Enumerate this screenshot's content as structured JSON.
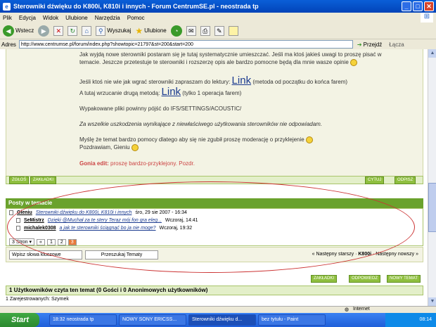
{
  "window": {
    "title": "Sterowniki dźwięku do K800i, K810i i innych - Forum CentrumSE.pl - neostrada tp"
  },
  "menu": [
    "Plik",
    "Edycja",
    "Widok",
    "Ulubione",
    "Narzędzia",
    "Pomoc"
  ],
  "toolbar": {
    "back": "Wstecz",
    "search": "Wyszukaj",
    "favorites": "Ulubione"
  },
  "address": {
    "label": "Adres",
    "url": "http://www.centrumse.pl/forum/index.php?showtopic=21797&st=200&start=200",
    "go": "Przejdź",
    "links": "Łącza"
  },
  "post": {
    "line1": "Jak wyjdą nowe sterowniki postaram się je tutaj systematycznie umieszczać. Jeśli ma ktoś jakieś uwagi to proszę pisać w",
    "line2": "temacie. Jeszcze przetestuje te sterowniki i rozszerzę opis ale bardzo pomocne będą dla mnie wasze opinie",
    "line3a": "Jeśli ktoś nie wie jak wgrać sterowniki zapraszam do lektury:",
    "link1": "Link",
    "line3b": "(metoda od początku do końca farem)",
    "line4a": "A tutaj wrzucanie drugą metodą:",
    "link2": "Link",
    "line4b": "(tylko 1 operacja farem)",
    "line5": "Wypakowane pliki powinny pójść do IFS/SETTINGS/ACOUSTIC/",
    "line6": "Za wszelkie uszkodzenia wynikające z niewłaściwego użytkowania sterowników nie odpowiadam.",
    "line7": "Myślę że temat bardzo pomocy dlatego aby się nie zgubił proszę moderację o przyklejenie",
    "line8": "Pozdrawiam, Gieniu",
    "edit_label": "Gonia edit:",
    "edit_text": "proszę bardzo-przyklejony. Pozdr."
  },
  "post_buttons": {
    "report": "ZGŁOŚ",
    "up": "ZAKŁADKI",
    "quote": "CYTUJ",
    "reply": "ODPISZ"
  },
  "posts_in_topic": {
    "heading": "Posty w temacie",
    "rows": [
      {
        "author": "Gieniu",
        "title": "Sterowniki dźwięku do K800i, K810i i innych",
        "date": "śro, 29 sie 2007 - 16:34"
      },
      {
        "author": "SeMistrz",
        "title": "Dzięki @Muchał za te stery Teraz mój fon gra eleg...",
        "date": "Wczoraj, 14:41"
      },
      {
        "author": "michalek0308",
        "title": "a jak te sterowniki ściągnąć bo ja nie moge?",
        "date": "Wczoraj, 19:32"
      }
    ],
    "pages_label": "3 Stron",
    "pages": [
      "«",
      "1",
      "2",
      "3"
    ]
  },
  "search": {
    "placeholder": "Wpisz słowa kluczowe",
    "button": "Przeszukaj Tematy"
  },
  "nav": {
    "prev": "« Następny starszy",
    "current": "K800i",
    "next": "Następny nowszy »"
  },
  "bottom_buttons": [
    "ZAKŁADKI",
    "ODPOWIEDZ",
    "NOWY TEMAT"
  ],
  "readers": {
    "heading": "1 Użytkowników czyta ten temat (0 Gości i 0 Anonimowych użytkowników)",
    "line": "1 Zarejestrowanych: Szymek"
  },
  "status": {
    "zone": "Internet"
  },
  "taskbar": {
    "start": "Start",
    "items": [
      "18:32 neostrada tp",
      "NOWY SONY ERICSS...",
      "Sterowniki dźwięku d...",
      "bez tytułu - Paint"
    ],
    "time": "08:14"
  }
}
